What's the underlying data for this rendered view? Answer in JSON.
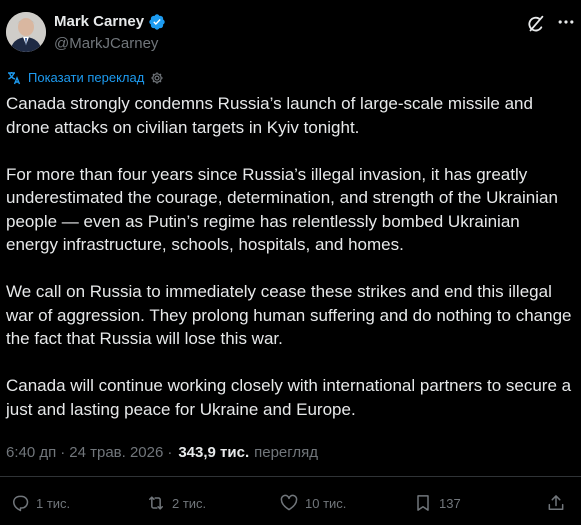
{
  "author": {
    "display_name": "Mark Carney",
    "handle": "@MarkJCarney",
    "verified_icon": "verified-badge-icon"
  },
  "translate": {
    "label": "Показати переклад"
  },
  "post": {
    "text": "Canada strongly condemns Russia’s launch of large-scale missile and drone attacks on civilian targets in Kyiv tonight.\n\nFor more than four years since Russia’s illegal invasion, it has greatly underestimated the courage, determination, and strength of the Ukrainian people — even as Putin’s regime has relentlessly bombed Ukrainian energy infrastructure, schools, hospitals, and homes.\n\nWe call on Russia to immediately cease these strikes and end this illegal war of aggression. They prolong human suffering and do nothing to change the fact that Russia will lose this war.\n\nCanada will continue working closely with international partners to secure a just and lasting peace for Ukraine and Europe."
  },
  "meta": {
    "time": "6:40 дп",
    "separator": "·",
    "date": "24 трав. 2026",
    "separator2": "·",
    "views": "343,9 тис.",
    "views_label": "перегляд"
  },
  "actions": {
    "replies": "1 тис.",
    "reposts": "2 тис.",
    "likes": "10 тис.",
    "bookmarks": "137"
  },
  "colors": {
    "background": "#000000",
    "text": "#e7e9ea",
    "muted": "#71767b",
    "accent": "#1d9bf0"
  }
}
